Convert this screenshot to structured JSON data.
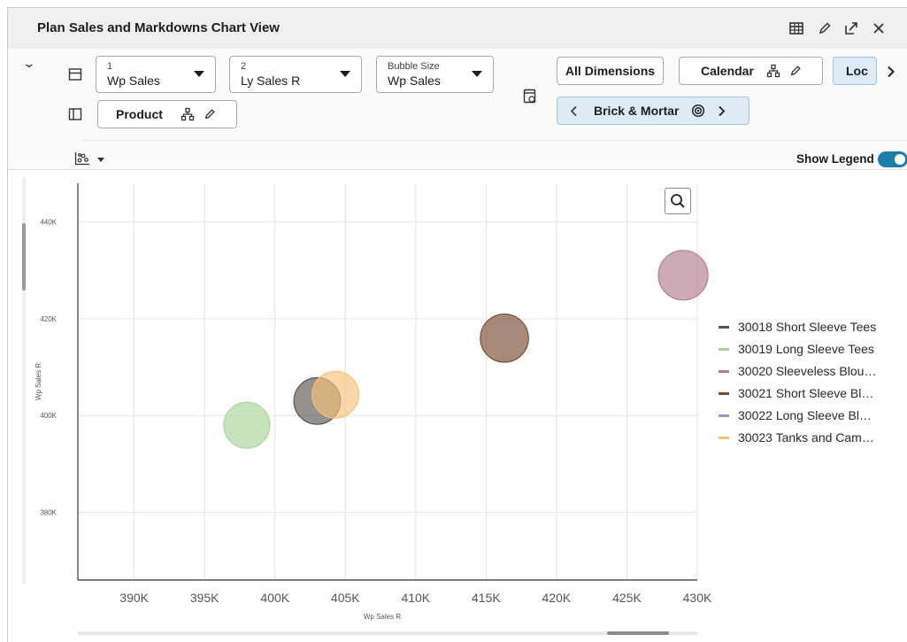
{
  "window": {
    "title": "Plan Sales and Markdowns Chart View"
  },
  "toolbar": {
    "measure1": {
      "index": "1",
      "value": "Wp Sales"
    },
    "measure2": {
      "index": "2",
      "value": "Ly Sales R"
    },
    "bubble": {
      "label": "Bubble Size",
      "value": "Wp Sales"
    },
    "row_dimension": "Product",
    "all_dimensions": "All Dimensions",
    "calendar": "Calendar",
    "location_short": "Loc",
    "location_value": "Brick & Mortar",
    "show_legend_label": "Show Legend",
    "show_legend_on": true
  },
  "chart_data": {
    "type": "scatter",
    "xlabel": "Wp Sales R",
    "ylabel": "Wp Sales R",
    "xlim": [
      386000,
      430000
    ],
    "ylim": [
      366000,
      448000
    ],
    "x_ticks": [
      "390K",
      "395K",
      "400K",
      "405K",
      "410K",
      "415K",
      "420K",
      "425K",
      "430K"
    ],
    "y_ticks": [
      "380K",
      "400K",
      "420K",
      "440K"
    ],
    "x_tick_values": [
      390000,
      395000,
      400000,
      405000,
      410000,
      415000,
      420000,
      425000,
      430000
    ],
    "y_tick_values": [
      380000,
      400000,
      420000,
      440000
    ],
    "grid": true,
    "legend_position": "right",
    "series": [
      {
        "name": "30018 Short Sleeve Tees",
        "color": "#5b5550",
        "x": 403000,
        "y": 403000,
        "size": 403000
      },
      {
        "name": "30019 Long Sleeve Tees",
        "color": "#a9d49a",
        "x": 398000,
        "y": 398000,
        "size": 398000
      },
      {
        "name": "30020 Sleeveless Blou…",
        "color": "#b47c8e",
        "x": 429000,
        "y": 429000,
        "size": 429000
      },
      {
        "name": "30021 Short Sleeve Bl…",
        "color": "#7a4a32",
        "x": 416300,
        "y": 416000,
        "size": 416000
      },
      {
        "name": "30022 Long Sleeve Bl…",
        "color": "#a98fd1",
        "x": null,
        "y": null,
        "size": null
      },
      {
        "name": "30023 Tanks and Cam…",
        "color": "#f7c27a",
        "x": 404300,
        "y": 404300,
        "size": 404300
      }
    ]
  }
}
